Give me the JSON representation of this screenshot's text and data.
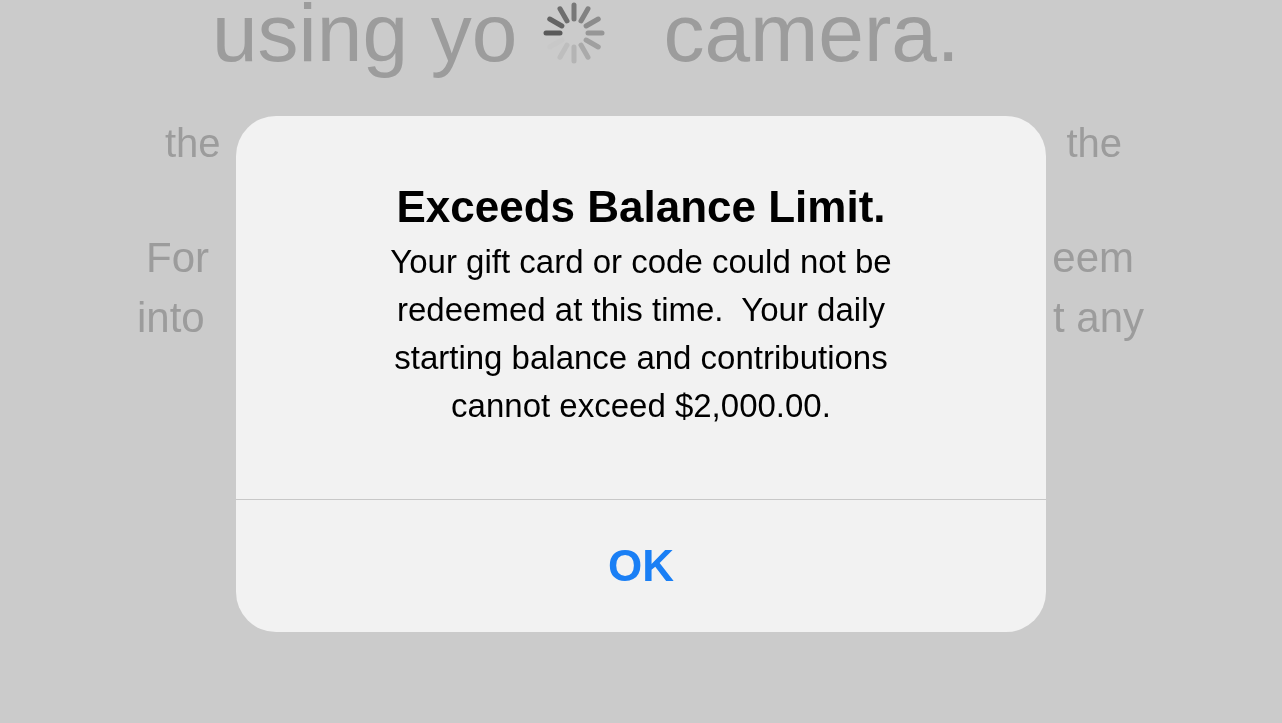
{
  "background": {
    "headline_left": "using yo",
    "headline_right": "camera.",
    "row_1": [
      "the",
      "the"
    ],
    "row_2": [
      "For",
      "eem"
    ],
    "row_3": [
      "into",
      "t any"
    ]
  },
  "alert": {
    "title": "Exceeds Balance Limit.",
    "message": "Your gift card or code could not be\nredeemed at this time.  Your daily\nstarting balance and contributions\ncannot exceed $2,000.00.",
    "buttons": [
      "OK"
    ]
  }
}
